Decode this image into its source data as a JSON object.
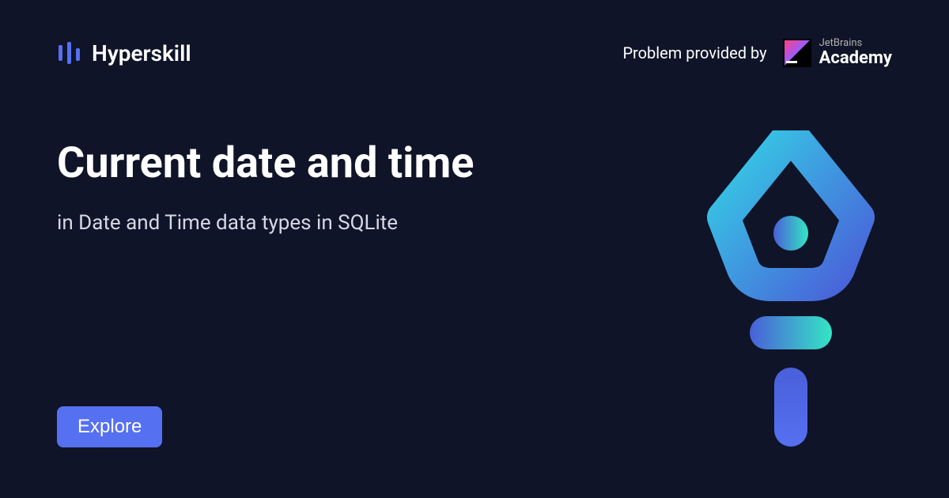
{
  "header": {
    "logo_text": "Hyperskill",
    "provided_by": "Problem provided by",
    "academy": {
      "brand": "JetBrains",
      "name": "Academy"
    }
  },
  "content": {
    "title": "Current date and time",
    "subtitle": "in Date and Time data types in SQLite"
  },
  "cta": {
    "explore": "Explore"
  }
}
